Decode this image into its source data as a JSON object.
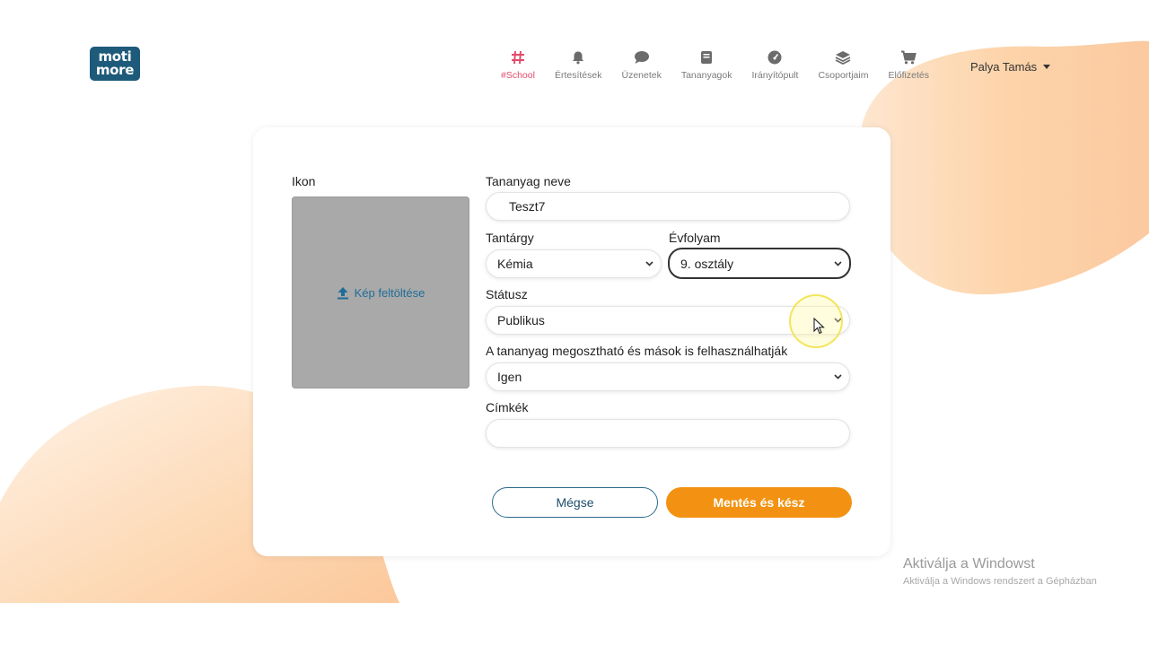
{
  "header": {
    "logo_line1": "moti",
    "logo_line2": "more",
    "nav": [
      {
        "label": "#School",
        "icon": "hash-icon",
        "active": true
      },
      {
        "label": "Értesítések",
        "icon": "bell-icon",
        "active": false
      },
      {
        "label": "Üzenetek",
        "icon": "chat-icon",
        "active": false
      },
      {
        "label": "Tananyagok",
        "icon": "book-icon",
        "active": false
      },
      {
        "label": "Irányítópult",
        "icon": "gauge-icon",
        "active": false
      },
      {
        "label": "Csoportjaim",
        "icon": "layers-icon",
        "active": false
      },
      {
        "label": "Előfizetés",
        "icon": "cart-icon",
        "active": false
      }
    ],
    "user_name": "Palya Tamás"
  },
  "form": {
    "icon_label": "Ikon",
    "upload_label": "Kép feltöltése",
    "name_label": "Tananyag neve",
    "name_value": "Teszt7",
    "subject_label": "Tantárgy",
    "subject_value": "Kémia",
    "grade_label": "Évfolyam",
    "grade_value": "9. osztály",
    "status_label": "Státusz",
    "status_value": "Publikus",
    "share_label": "A tananyag megosztható és mások is felhasználhatják",
    "share_value": "Igen",
    "tags_label": "Címkék",
    "tags_value": "",
    "cancel_label": "Mégse",
    "save_label": "Mentés és kész"
  },
  "watermark": {
    "line1": "Aktiválja a Windowst",
    "line2": "Aktiválja a Windows rendszert a Gépházban"
  },
  "colors": {
    "accent": "#f39212",
    "active_nav": "#e34b6a",
    "link": "#1f6d99",
    "brand": "#1e5a7a",
    "blob": "#fdd7b0"
  }
}
